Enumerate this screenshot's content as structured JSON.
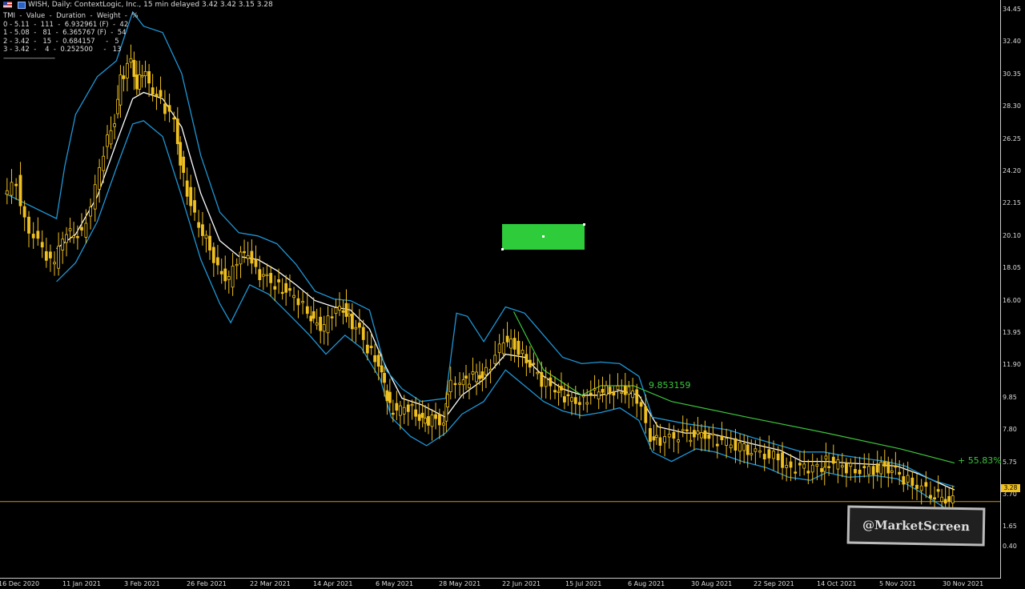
{
  "header": {
    "title": "WISH, Daily:  ContextLogic, Inc., 15 min delayed  3.42  3.42  3.15  3.28"
  },
  "legend": {
    "title_line": "TMI  -  Value  -  Duration  -  Weight  -  %",
    "rows": [
      "0 - 5.11  -  111  -  6.932961 (F)  -  42",
      "1 - 5.08  -   81  -  6.365767 (F)  -  54",
      "2 - 3.42  -   15  -  0.684157     -   5",
      "3 - 3.42  -    4  -  0.252500     -   13"
    ],
    "separator": "-------------------------------"
  },
  "price_tag": "3.28",
  "annotations": {
    "line_value": "9.853159",
    "percent": "+ 55.83%"
  },
  "watermark": "@MarketScreen",
  "colors": {
    "background": "#000000",
    "candle": "#f0c020",
    "band": "#1e96d6",
    "midline": "#ffffff",
    "trend": "#3cc63c",
    "price_line": "#c8961e",
    "box": "#2ecc3a"
  },
  "chart_data": {
    "type": "line",
    "title": "WISH, Daily:  ContextLogic, Inc., 15 min delayed  3.42  3.42  3.15  3.28",
    "ylim": [
      0.0,
      35.0
    ],
    "y_ticks": [
      "34.45",
      "32.40",
      "30.35",
      "28.30",
      "26.25",
      "24.20",
      "22.15",
      "20.10",
      "18.05",
      "16.00",
      "13.95",
      "11.90",
      "9.85",
      "7.80",
      "5.75",
      "3.70",
      "1.65",
      "0.40"
    ],
    "x_ticks": [
      "16 Dec 2020",
      "11 Jan 2021",
      "3 Feb 2021",
      "26 Feb 2021",
      "22 Mar 2021",
      "14 Apr 2021",
      "6 May 2021",
      "28 May 2021",
      "22 Jun 2021",
      "15 Jul 2021",
      "6 Aug 2021",
      "30 Aug 2021",
      "22 Sep 2021",
      "14 Oct 2021",
      "5 Nov 2021",
      "30 Nov 2021"
    ],
    "last_price": 3.28,
    "series": [
      {
        "name": "close",
        "points": [
          [
            "2020-12-16",
            22.5
          ],
          [
            "2020-12-21",
            23.6
          ],
          [
            "2020-12-24",
            21.0
          ],
          [
            "2020-12-29",
            19.6
          ],
          [
            "2021-01-04",
            18.2
          ],
          [
            "2021-01-07",
            20.0
          ],
          [
            "2021-01-11",
            20.4
          ],
          [
            "2021-01-14",
            20.2
          ],
          [
            "2021-01-19",
            23.0
          ],
          [
            "2021-01-22",
            25.5
          ],
          [
            "2021-01-26",
            27.5
          ],
          [
            "2021-01-28",
            30.0
          ],
          [
            "2021-02-01",
            31.2
          ],
          [
            "2021-02-03",
            29.6
          ],
          [
            "2021-02-05",
            30.6
          ],
          [
            "2021-02-09",
            29.4
          ],
          [
            "2021-02-12",
            28.6
          ],
          [
            "2021-02-17",
            27.4
          ],
          [
            "2021-02-19",
            24.8
          ],
          [
            "2021-02-23",
            22.0
          ],
          [
            "2021-02-26",
            20.6
          ],
          [
            "2021-03-02",
            19.4
          ],
          [
            "2021-03-05",
            18.1
          ],
          [
            "2021-03-09",
            17.2
          ],
          [
            "2021-03-12",
            18.6
          ],
          [
            "2021-03-16",
            19.2
          ],
          [
            "2021-03-19",
            17.8
          ],
          [
            "2021-03-23",
            17.4
          ],
          [
            "2021-03-26",
            17.0
          ],
          [
            "2021-03-30",
            16.6
          ],
          [
            "2021-04-02",
            16.2
          ],
          [
            "2021-04-07",
            15.3
          ],
          [
            "2021-04-09",
            14.8
          ],
          [
            "2021-04-13",
            14.2
          ],
          [
            "2021-04-16",
            15.2
          ],
          [
            "2021-04-20",
            15.6
          ],
          [
            "2021-04-22",
            14.8
          ],
          [
            "2021-04-26",
            14.0
          ],
          [
            "2021-04-29",
            13.0
          ],
          [
            "2021-05-03",
            12.0
          ],
          [
            "2021-05-05",
            10.6
          ],
          [
            "2021-05-07",
            9.2
          ],
          [
            "2021-05-11",
            9.0
          ],
          [
            "2021-05-14",
            9.3
          ],
          [
            "2021-05-18",
            8.6
          ],
          [
            "2021-05-20",
            8.3
          ],
          [
            "2021-05-24",
            8.5
          ],
          [
            "2021-05-27",
            8.3
          ],
          [
            "2021-05-28",
            10.4
          ],
          [
            "2021-06-02",
            11.0
          ],
          [
            "2021-06-04",
            10.8
          ],
          [
            "2021-06-08",
            11.4
          ],
          [
            "2021-06-10",
            11.2
          ],
          [
            "2021-06-15",
            12.4
          ],
          [
            "2021-06-18",
            13.4
          ],
          [
            "2021-06-22",
            13.2
          ],
          [
            "2021-06-25",
            12.6
          ],
          [
            "2021-06-29",
            11.6
          ],
          [
            "2021-07-02",
            10.9
          ],
          [
            "2021-07-07",
            10.5
          ],
          [
            "2021-07-09",
            10.0
          ],
          [
            "2021-07-13",
            9.7
          ],
          [
            "2021-07-16",
            9.6
          ],
          [
            "2021-07-20",
            10.0
          ],
          [
            "2021-07-23",
            10.2
          ],
          [
            "2021-07-27",
            10.3
          ],
          [
            "2021-07-30",
            10.4
          ],
          [
            "2021-08-03",
            10.2
          ],
          [
            "2021-08-06",
            9.8
          ],
          [
            "2021-08-11",
            7.4
          ],
          [
            "2021-08-13",
            7.1
          ],
          [
            "2021-08-18",
            7.3
          ],
          [
            "2021-08-23",
            7.5
          ],
          [
            "2021-08-27",
            7.4
          ],
          [
            "2021-08-31",
            7.6
          ],
          [
            "2021-09-03",
            7.2
          ],
          [
            "2021-09-08",
            7.0
          ],
          [
            "2021-09-13",
            6.7
          ],
          [
            "2021-09-17",
            6.4
          ],
          [
            "2021-09-22",
            6.3
          ],
          [
            "2021-09-27",
            6.0
          ],
          [
            "2021-09-30",
            5.5
          ],
          [
            "2021-10-05",
            5.3
          ],
          [
            "2021-10-08",
            5.3
          ],
          [
            "2021-10-13",
            5.5
          ],
          [
            "2021-10-14",
            5.8
          ],
          [
            "2021-10-19",
            5.6
          ],
          [
            "2021-10-22",
            5.4
          ],
          [
            "2021-10-27",
            5.2
          ],
          [
            "2021-11-01",
            5.3
          ],
          [
            "2021-11-05",
            5.5
          ],
          [
            "2021-11-09",
            5.1
          ],
          [
            "2021-11-12",
            4.7
          ],
          [
            "2021-11-17",
            4.3
          ],
          [
            "2021-11-22",
            3.8
          ],
          [
            "2021-11-26",
            3.5
          ],
          [
            "2021-11-30",
            3.28
          ]
        ]
      },
      {
        "name": "average",
        "points": [
          [
            "2021-01-04",
            19.3
          ],
          [
            "2021-01-11",
            20.2
          ],
          [
            "2021-01-19",
            22.6
          ],
          [
            "2021-01-26",
            26.0
          ],
          [
            "2021-02-01",
            28.8
          ],
          [
            "2021-02-05",
            29.2
          ],
          [
            "2021-02-12",
            28.8
          ],
          [
            "2021-02-19",
            27.0
          ],
          [
            "2021-02-26",
            22.8
          ],
          [
            "2021-03-05",
            19.8
          ],
          [
            "2021-03-12",
            18.8
          ],
          [
            "2021-03-19",
            18.6
          ],
          [
            "2021-03-26",
            17.9
          ],
          [
            "2021-04-02",
            17.0
          ],
          [
            "2021-04-09",
            16.0
          ],
          [
            "2021-04-16",
            15.6
          ],
          [
            "2021-04-22",
            15.4
          ],
          [
            "2021-04-29",
            14.2
          ],
          [
            "2021-05-05",
            11.8
          ],
          [
            "2021-05-11",
            9.8
          ],
          [
            "2021-05-18",
            9.4
          ],
          [
            "2021-05-27",
            8.6
          ],
          [
            "2021-06-02",
            10.0
          ],
          [
            "2021-06-10",
            11.0
          ],
          [
            "2021-06-18",
            12.6
          ],
          [
            "2021-06-25",
            12.4
          ],
          [
            "2021-07-02",
            11.2
          ],
          [
            "2021-07-09",
            10.4
          ],
          [
            "2021-07-16",
            10.0
          ],
          [
            "2021-07-23",
            10.0
          ],
          [
            "2021-07-30",
            10.3
          ],
          [
            "2021-08-06",
            10.0
          ],
          [
            "2021-08-13",
            8.0
          ],
          [
            "2021-08-23",
            7.6
          ],
          [
            "2021-08-31",
            7.6
          ],
          [
            "2021-09-08",
            7.3
          ],
          [
            "2021-09-17",
            6.9
          ],
          [
            "2021-09-27",
            6.5
          ],
          [
            "2021-10-05",
            5.8
          ],
          [
            "2021-10-14",
            5.8
          ],
          [
            "2021-10-22",
            5.7
          ],
          [
            "2021-11-01",
            5.6
          ],
          [
            "2021-11-09",
            5.5
          ],
          [
            "2021-11-17",
            5.0
          ],
          [
            "2021-11-26",
            4.3
          ],
          [
            "2021-11-30",
            4.0
          ]
        ]
      },
      {
        "name": "upper band",
        "points": [
          [
            "2020-12-16",
            22.8
          ],
          [
            "2021-01-04",
            21.2
          ],
          [
            "2021-01-07",
            24.5
          ],
          [
            "2021-01-11",
            27.8
          ],
          [
            "2021-01-19",
            30.2
          ],
          [
            "2021-01-26",
            31.2
          ],
          [
            "2021-02-01",
            34.3
          ],
          [
            "2021-02-05",
            33.4
          ],
          [
            "2021-02-12",
            33.0
          ],
          [
            "2021-02-19",
            30.4
          ],
          [
            "2021-02-26",
            25.2
          ],
          [
            "2021-03-05",
            21.6
          ],
          [
            "2021-03-12",
            20.3
          ],
          [
            "2021-03-19",
            20.1
          ],
          [
            "2021-03-26",
            19.6
          ],
          [
            "2021-04-02",
            18.3
          ],
          [
            "2021-04-09",
            16.6
          ],
          [
            "2021-04-16",
            16.1
          ],
          [
            "2021-04-22",
            16.0
          ],
          [
            "2021-04-29",
            15.4
          ],
          [
            "2021-05-05",
            11.6
          ],
          [
            "2021-05-11",
            10.4
          ],
          [
            "2021-05-18",
            9.6
          ],
          [
            "2021-05-27",
            9.8
          ],
          [
            "2021-05-31",
            15.2
          ],
          [
            "2021-06-04",
            15.0
          ],
          [
            "2021-06-10",
            13.4
          ],
          [
            "2021-06-18",
            15.6
          ],
          [
            "2021-06-25",
            15.2
          ],
          [
            "2021-07-02",
            13.8
          ],
          [
            "2021-07-09",
            12.4
          ],
          [
            "2021-07-16",
            12.0
          ],
          [
            "2021-07-23",
            12.1
          ],
          [
            "2021-07-30",
            12.0
          ],
          [
            "2021-08-06",
            11.2
          ],
          [
            "2021-08-11",
            8.6
          ],
          [
            "2021-08-23",
            8.2
          ],
          [
            "2021-08-31",
            8.0
          ],
          [
            "2021-09-08",
            7.8
          ],
          [
            "2021-09-17",
            7.3
          ],
          [
            "2021-09-27",
            6.8
          ],
          [
            "2021-10-05",
            6.4
          ],
          [
            "2021-10-13",
            6.4
          ],
          [
            "2021-10-19",
            6.2
          ],
          [
            "2021-10-27",
            6.0
          ],
          [
            "2021-11-05",
            5.8
          ],
          [
            "2021-11-12",
            5.5
          ],
          [
            "2021-11-22",
            4.6
          ],
          [
            "2021-11-30",
            4.2
          ]
        ]
      },
      {
        "name": "lower band",
        "points": [
          [
            "2021-01-04",
            17.2
          ],
          [
            "2021-01-11",
            18.4
          ],
          [
            "2021-01-19",
            21.0
          ],
          [
            "2021-01-26",
            24.4
          ],
          [
            "2021-02-01",
            27.2
          ],
          [
            "2021-02-05",
            27.4
          ],
          [
            "2021-02-12",
            26.4
          ],
          [
            "2021-02-19",
            22.6
          ],
          [
            "2021-02-26",
            18.6
          ],
          [
            "2021-03-05",
            15.8
          ],
          [
            "2021-03-09",
            14.6
          ],
          [
            "2021-03-16",
            17.0
          ],
          [
            "2021-03-23",
            16.4
          ],
          [
            "2021-03-30",
            15.2
          ],
          [
            "2021-04-07",
            13.8
          ],
          [
            "2021-04-13",
            12.6
          ],
          [
            "2021-04-20",
            13.8
          ],
          [
            "2021-04-26",
            13.0
          ],
          [
            "2021-05-03",
            11.0
          ],
          [
            "2021-05-07",
            8.6
          ],
          [
            "2021-05-14",
            7.4
          ],
          [
            "2021-05-20",
            6.8
          ],
          [
            "2021-05-27",
            7.6
          ],
          [
            "2021-06-02",
            8.8
          ],
          [
            "2021-06-10",
            9.6
          ],
          [
            "2021-06-18",
            11.6
          ],
          [
            "2021-06-25",
            10.6
          ],
          [
            "2021-07-02",
            9.6
          ],
          [
            "2021-07-09",
            9.0
          ],
          [
            "2021-07-16",
            8.7
          ],
          [
            "2021-07-23",
            8.9
          ],
          [
            "2021-07-30",
            9.2
          ],
          [
            "2021-08-06",
            8.4
          ],
          [
            "2021-08-11",
            6.4
          ],
          [
            "2021-08-18",
            5.8
          ],
          [
            "2021-08-27",
            6.6
          ],
          [
            "2021-09-03",
            6.4
          ],
          [
            "2021-09-13",
            5.8
          ],
          [
            "2021-09-22",
            5.4
          ],
          [
            "2021-09-30",
            4.8
          ],
          [
            "2021-10-08",
            4.6
          ],
          [
            "2021-10-14",
            5.1
          ],
          [
            "2021-10-22",
            4.8
          ],
          [
            "2021-11-01",
            4.9
          ],
          [
            "2021-11-09",
            4.7
          ],
          [
            "2021-11-17",
            3.9
          ],
          [
            "2021-11-26",
            2.9
          ],
          [
            "2021-11-30",
            2.6
          ]
        ]
      },
      {
        "name": "trend",
        "points": [
          [
            "2021-06-21",
            15.3
          ],
          [
            "2021-07-02",
            11.6
          ],
          [
            "2021-07-16",
            10.0
          ],
          [
            "2021-07-23",
            10.6
          ],
          [
            "2021-08-04",
            10.6
          ],
          [
            "2021-08-18",
            9.6
          ],
          [
            "2021-09-15",
            8.6
          ],
          [
            "2021-10-14",
            7.6
          ],
          [
            "2021-11-10",
            6.6
          ],
          [
            "2021-11-30",
            5.7
          ]
        ]
      }
    ]
  }
}
